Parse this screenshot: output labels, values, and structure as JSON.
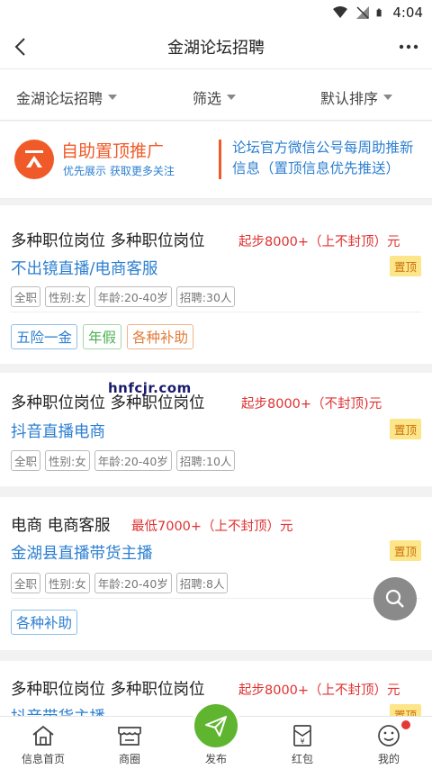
{
  "status": {
    "time": "4:04"
  },
  "header": {
    "title": "金湖论坛招聘"
  },
  "filters": [
    {
      "label": "金湖论坛招聘"
    },
    {
      "label": "筛选"
    },
    {
      "label": "默认排序"
    }
  ],
  "promo": {
    "title": "自助置顶推广",
    "subtitle": "优先展示  获取更多关注",
    "right_text": "论坛官方微信公号每周助推新信息（置顶信息优先推送）"
  },
  "jobs": [
    {
      "title": "多种职位岗位 多种职位岗位",
      "salary": "起步8000+（上不封顶）元",
      "subtitle": "不出镜直播/电商客服",
      "pin": "置顶",
      "tags": [
        "全职",
        "性别:女",
        "年龄:20-40岁",
        "招聘:30人"
      ],
      "benefits": [
        "五险一金",
        "年假",
        "各种补助"
      ]
    },
    {
      "title": "多种职位岗位 多种职位岗位",
      "salary": "起步8000+（不封顶)元",
      "subtitle": "抖音直播电商",
      "pin": "置顶",
      "tags": [
        "全职",
        "性别:女",
        "年龄:20-40岁",
        "招聘:10人"
      ],
      "benefits": []
    },
    {
      "title": "电商 电商客服",
      "salary": "最低7000+（上不封顶）元",
      "subtitle": "金湖县直播带货主播",
      "pin": "置顶",
      "tags": [
        "全职",
        "性别:女",
        "年龄:20-40岁",
        "招聘:8人"
      ],
      "benefits": [
        "各种补助"
      ]
    },
    {
      "title": "多种职位岗位 多种职位岗位",
      "salary": "起步8000+（上不封顶）元",
      "subtitle": "抖音带货主播",
      "pin": "置顶",
      "tags": [],
      "benefits": []
    }
  ],
  "watermark": "hnfcjr.com",
  "tabbar": [
    {
      "label": "信息首页",
      "icon": "home-icon"
    },
    {
      "label": "商圈",
      "icon": "store-icon"
    },
    {
      "label": "发布",
      "icon": "send-icon"
    },
    {
      "label": "红包",
      "icon": "red-envelope-icon"
    },
    {
      "label": "我的",
      "icon": "smiley-icon"
    }
  ],
  "colors": {
    "accent_orange": "#f05a28",
    "link_blue": "#2c7fd1",
    "salary_red": "#e03131",
    "post_green": "#5fb52f",
    "pin_bg": "#fde58a"
  }
}
